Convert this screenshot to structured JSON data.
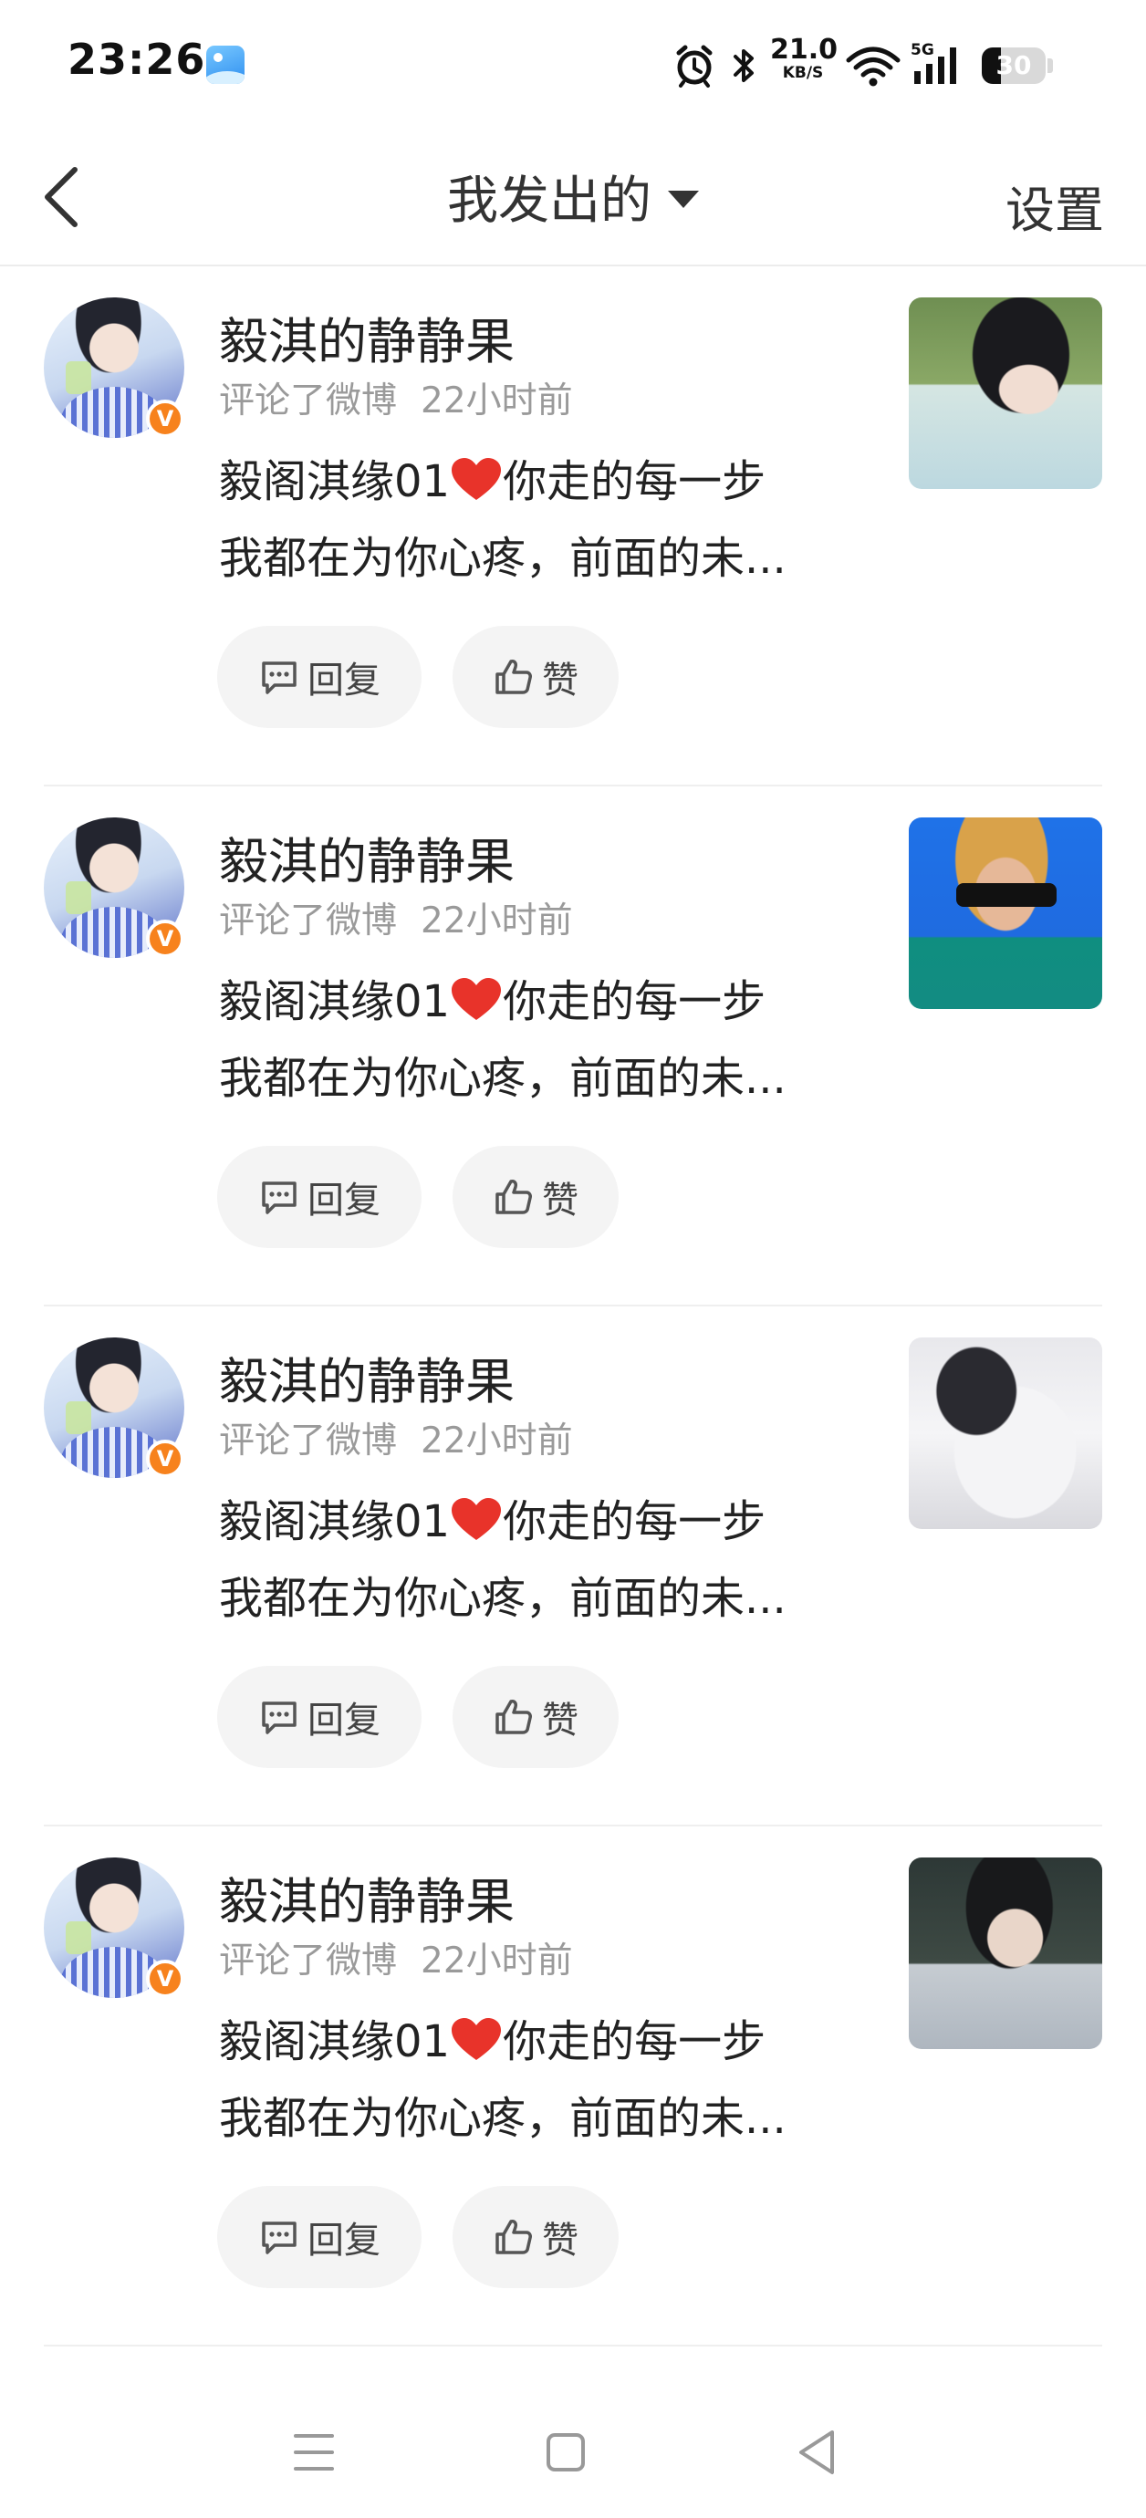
{
  "status_bar": {
    "time": "23:26",
    "network_speed_value": "21.0",
    "network_speed_unit": "KB/S",
    "signal_label": "5G",
    "battery_level": "30",
    "icons": [
      "gallery-icon",
      "alarm-icon",
      "bluetooth-icon",
      "wifi-icon",
      "cellular-signal-icon",
      "battery-icon"
    ]
  },
  "navbar": {
    "title": "我发出的",
    "settings_label": "设置",
    "icons": [
      "back-arrow-icon",
      "dropdown-caret-icon"
    ]
  },
  "colors": {
    "vip_badge": "#f7821d",
    "heart": "#e8332a",
    "meta_text": "#9a9a9a",
    "button_bg": "#f4f4f4"
  },
  "feed": {
    "items": [
      {
        "username": "毅淇的静静果",
        "action": "评论了微博",
        "time": "22小时前",
        "comment_part1": "毅阁淇缘01",
        "comment_part2": "你走的每一步",
        "comment_line2": "我都在为你心疼，前面的未...",
        "reply_label": "回复",
        "like_label": "赞",
        "vip_mark": "V"
      },
      {
        "username": "毅淇的静静果",
        "action": "评论了微博",
        "time": "22小时前",
        "comment_part1": "毅阁淇缘01",
        "comment_part2": "你走的每一步",
        "comment_line2": "我都在为你心疼，前面的未...",
        "reply_label": "回复",
        "like_label": "赞",
        "vip_mark": "V"
      },
      {
        "username": "毅淇的静静果",
        "action": "评论了微博",
        "time": "22小时前",
        "comment_part1": "毅阁淇缘01",
        "comment_part2": "你走的每一步",
        "comment_line2": "我都在为你心疼，前面的未...",
        "reply_label": "回复",
        "like_label": "赞",
        "vip_mark": "V"
      },
      {
        "username": "毅淇的静静果",
        "action": "评论了微博",
        "time": "22小时前",
        "comment_part1": "毅阁淇缘01",
        "comment_part2": "你走的每一步",
        "comment_line2": "我都在为你心疼，前面的未...",
        "reply_label": "回复",
        "like_label": "赞",
        "vip_mark": "V"
      }
    ]
  },
  "system_nav": {
    "icons": [
      "recent-apps-icon",
      "home-icon",
      "system-back-icon"
    ]
  }
}
